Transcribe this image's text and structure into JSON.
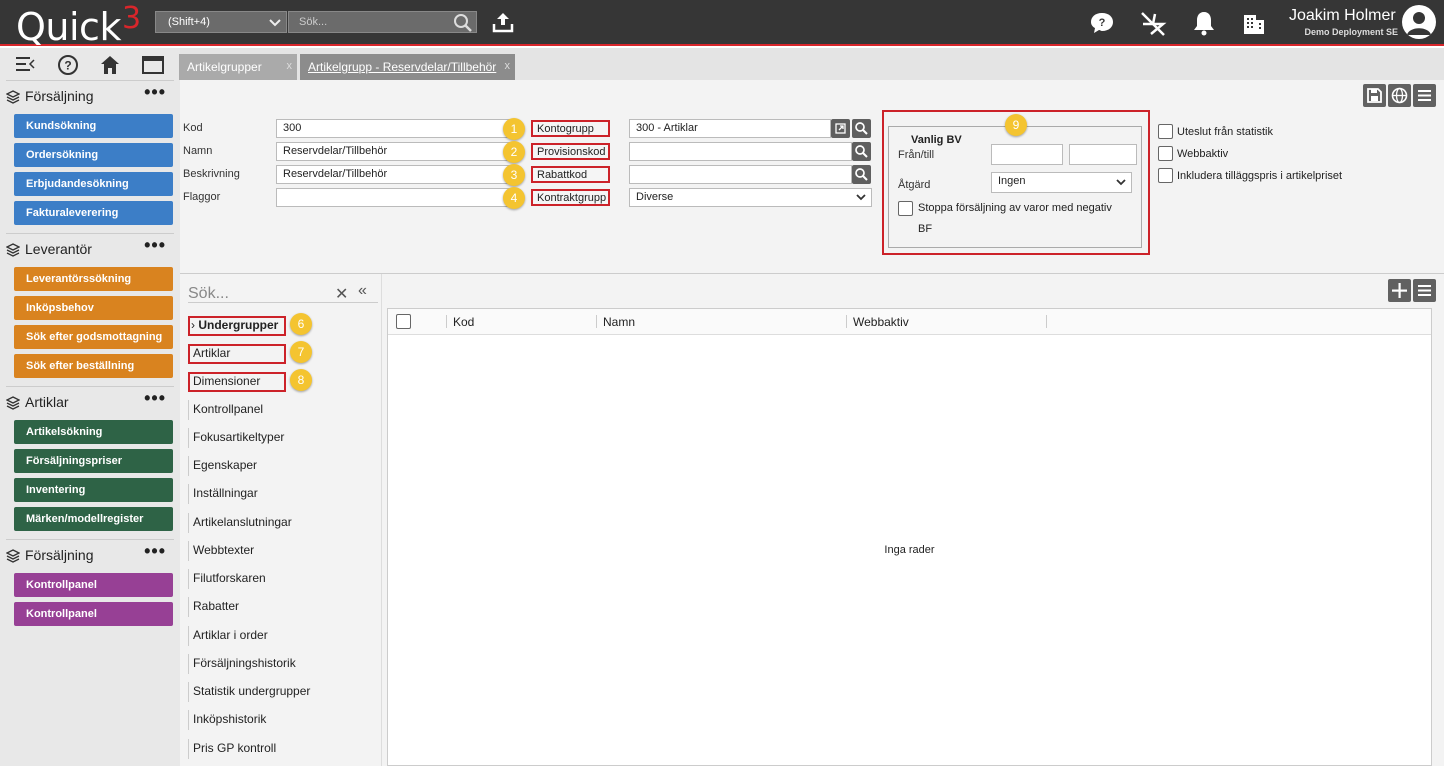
{
  "app": {
    "logo_text": "Quick",
    "logo_num": "3",
    "shortcut_select": "(Shift+4)",
    "search_placeholder": "Sök...",
    "user_name": "Joakim Holmer",
    "deployment": "Demo Deployment SE"
  },
  "sidebar": {
    "sections": [
      {
        "title": "Försäljning",
        "items": [
          "Kundsökning",
          "Ordersökning",
          "Erbjudandesökning",
          "Fakturaleverering"
        ]
      },
      {
        "title": "Leverantör",
        "items": [
          "Leverantörssökning",
          "Inköpsbehov",
          "Sök efter godsmottagning",
          "Sök efter beställning"
        ]
      },
      {
        "title": "Artiklar",
        "items": [
          "Artikelsökning",
          "Försäljningspriser",
          "Inventering",
          "Märken/modellregister"
        ]
      },
      {
        "title": "Försäljning",
        "items": [
          "Kontrollpanel",
          "Kontrollpanel"
        ]
      }
    ],
    "more": "•••"
  },
  "tabs": [
    {
      "label": "Artikelgrupper",
      "close": "x"
    },
    {
      "label": "Artikelgrupp - Reservdelar/Tillbehör",
      "close": "x"
    }
  ],
  "form": {
    "kod_label": "Kod",
    "kod_value": "300",
    "namn_label": "Namn",
    "namn_value": "Reservdelar/Tillbehör",
    "beskr_label": "Beskrivning",
    "beskr_value": "Reservdelar/Tillbehör",
    "flaggor_label": "Flaggor",
    "flaggor_value": "",
    "kontogrupp_label": "Kontogrupp",
    "kontogrupp_value": "300 - Artiklar",
    "provisionskod_label": "Provisionskod",
    "provisionskod_value": "",
    "rabattkod_label": "Rabattkod",
    "rabattkod_value": "",
    "kontraktgrupp_label": "Kontraktgrupp",
    "kontraktgrupp_value": "Diverse"
  },
  "vanligbv": {
    "title": "Vanlig BV",
    "frantill_label": "Från/till",
    "from_value": "",
    "to_value": "",
    "atgard_label": "Åtgärd",
    "atgard_value": "Ingen",
    "stoppa_line1": "Stoppa försäljning av varor med negativ",
    "stoppa_line2": "BF"
  },
  "checkboxes": [
    "Uteslut från statistik",
    "Webbaktiv",
    "Inkludera tilläggspris i artikelpriset"
  ],
  "badges": [
    "1",
    "2",
    "3",
    "4",
    "6",
    "7",
    "8",
    "9"
  ],
  "list": {
    "search_placeholder": "Sök...",
    "items": [
      "Undergrupper",
      "Artiklar",
      "Dimensioner",
      "Kontrollpanel",
      "Fokusartikeltyper",
      "Egenskaper",
      "Inställningar",
      "Artikelanslutningar",
      "Webbtexter",
      "Filutforskaren",
      "Rabatter",
      "Artiklar i order",
      "Försäljningshistorik",
      "Statistik undergrupper",
      "Inköpshistorik",
      "Pris GP kontroll"
    ]
  },
  "grid": {
    "columns": [
      "Kod",
      "Namn",
      "Webbaktiv"
    ],
    "empty_text": "Inga rader"
  },
  "colors": {
    "topbar": "#363636",
    "accent_red": "#d8262b",
    "blue": "#3c7ec7",
    "orange": "#d9831f",
    "green": "#2e6346",
    "purple": "#974095",
    "badge": "#f4c430"
  }
}
